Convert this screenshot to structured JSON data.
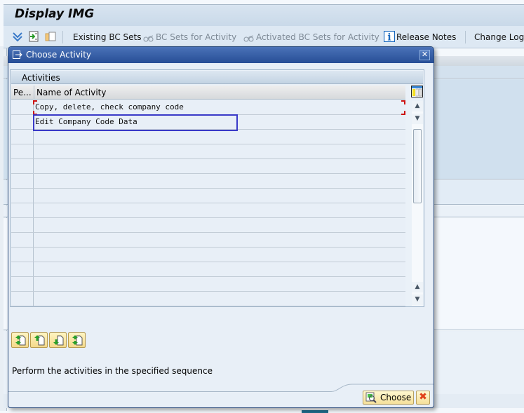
{
  "app": {
    "title": "Display IMG",
    "toolbar": {
      "items": [
        {
          "label": "Existing BC Sets",
          "enabled": true
        },
        {
          "label": "BC Sets for Activity",
          "enabled": false
        },
        {
          "label": "Activated BC Sets for Activity",
          "enabled": false
        },
        {
          "label": "Release Notes",
          "enabled": true,
          "icon": "info-icon"
        },
        {
          "label": "Change Log",
          "enabled": true
        }
      ],
      "icons": [
        "expand-icon",
        "execute-icon",
        "copy-icon"
      ]
    }
  },
  "dialog": {
    "title": "Choose Activity",
    "close_symbol": "✕",
    "table": {
      "title": "Activities",
      "columns": [
        "Pe...",
        "Name of Activity"
      ],
      "rows": [
        {
          "name": "Copy, delete, check company code"
        },
        {
          "name": "Edit Company Code Data"
        },
        {
          "name": ""
        },
        {
          "name": ""
        },
        {
          "name": ""
        },
        {
          "name": ""
        },
        {
          "name": ""
        },
        {
          "name": ""
        },
        {
          "name": ""
        },
        {
          "name": ""
        },
        {
          "name": ""
        },
        {
          "name": ""
        },
        {
          "name": ""
        },
        {
          "name": ""
        }
      ],
      "focused_row": 1
    },
    "order_buttons": [
      "move-top-icon",
      "move-up-icon",
      "move-down-icon",
      "move-bottom-icon"
    ],
    "hint": "Perform the activities in the specified sequence",
    "choose_label": "Choose",
    "cancel_symbol": "✖",
    "colors": {
      "header": "#274e96",
      "focus_border": "#3a3ac8",
      "cancel": "#e0401a"
    }
  }
}
